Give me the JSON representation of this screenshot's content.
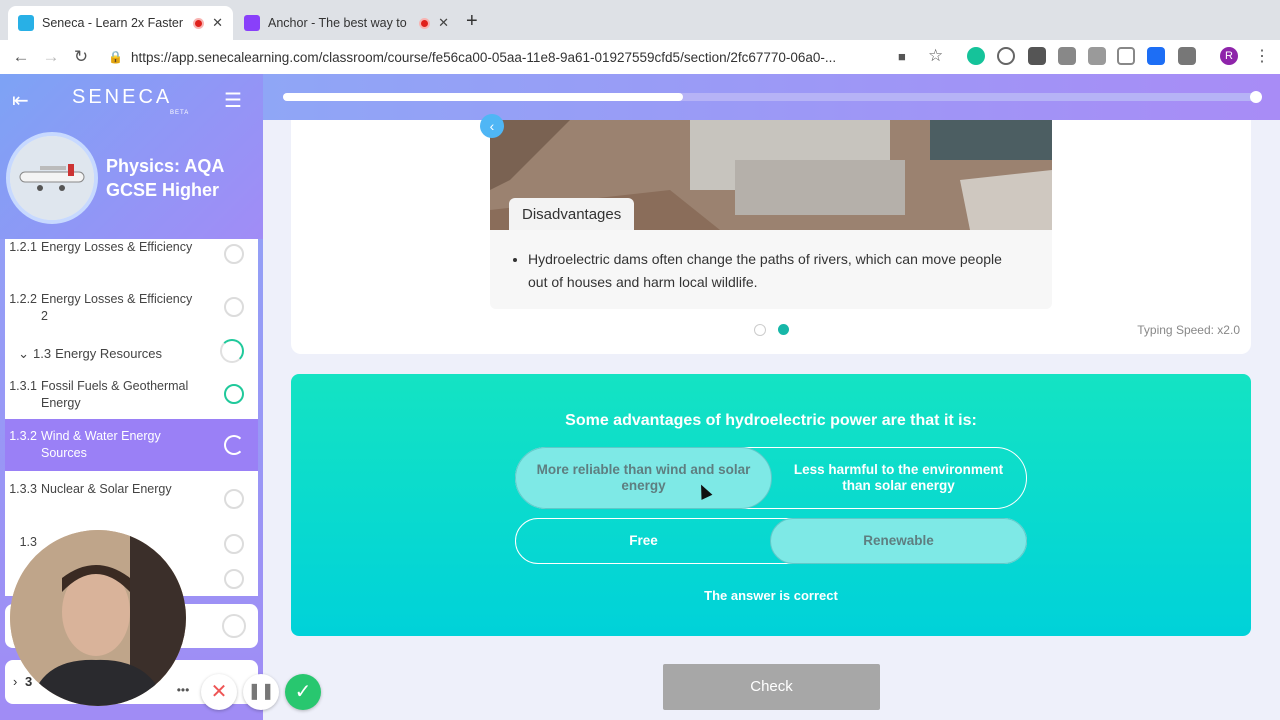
{
  "browser": {
    "tabs": [
      {
        "title": "Seneca - Learn 2x Faster",
        "favicon_color": "#28b0e6"
      },
      {
        "title": "Anchor - The best way to make a podcast",
        "favicon_color": "#8940fa"
      }
    ],
    "url": "https://app.senecalearning.com/classroom/course/fe56ca00-05aa-11e8-9a61-01927559cfd5/section/2fc67770-06a0-..."
  },
  "sidebar": {
    "logo": "SENECA",
    "logo_sub": "BETA",
    "course_title_line1": "Physics: AQA",
    "course_title_line2": "GCSE Higher",
    "items": [
      {
        "num": "1.2.1",
        "label": "Energy Losses & Efficiency"
      },
      {
        "num": "1.2.2",
        "label": "Energy Losses & Efficiency 2"
      },
      {
        "num": "1.3",
        "label": "Energy Resources"
      },
      {
        "num": "1.3.1",
        "label": "Fossil Fuels & Geothermal Energy"
      },
      {
        "num": "1.3.2",
        "label": "Wind & Water Energy Sources"
      },
      {
        "num": "1.3.3",
        "label": "Nuclear & Solar Energy"
      },
      {
        "num": "1.3",
        "label": ""
      }
    ],
    "bottom_item": "3"
  },
  "progress": {
    "fraction": 0.41
  },
  "content": {
    "section_label": "Disadvantages",
    "bullet": "Hydroelectric dams often change the paths of rivers, which can move people out of houses and harm local wildlife.",
    "typing_speed": "Typing Speed: x2.0"
  },
  "quiz": {
    "question": "Some advantages of hydroelectric power are that it is:",
    "options": [
      {
        "label": "More reliable than wind and solar energy",
        "selected": true
      },
      {
        "label": "Less harmful to the environment than solar energy",
        "selected": false
      },
      {
        "label": "Free",
        "selected": false
      },
      {
        "label": "Renewable",
        "selected": true
      }
    ],
    "feedback": "The answer is correct"
  },
  "check_label": "Check"
}
